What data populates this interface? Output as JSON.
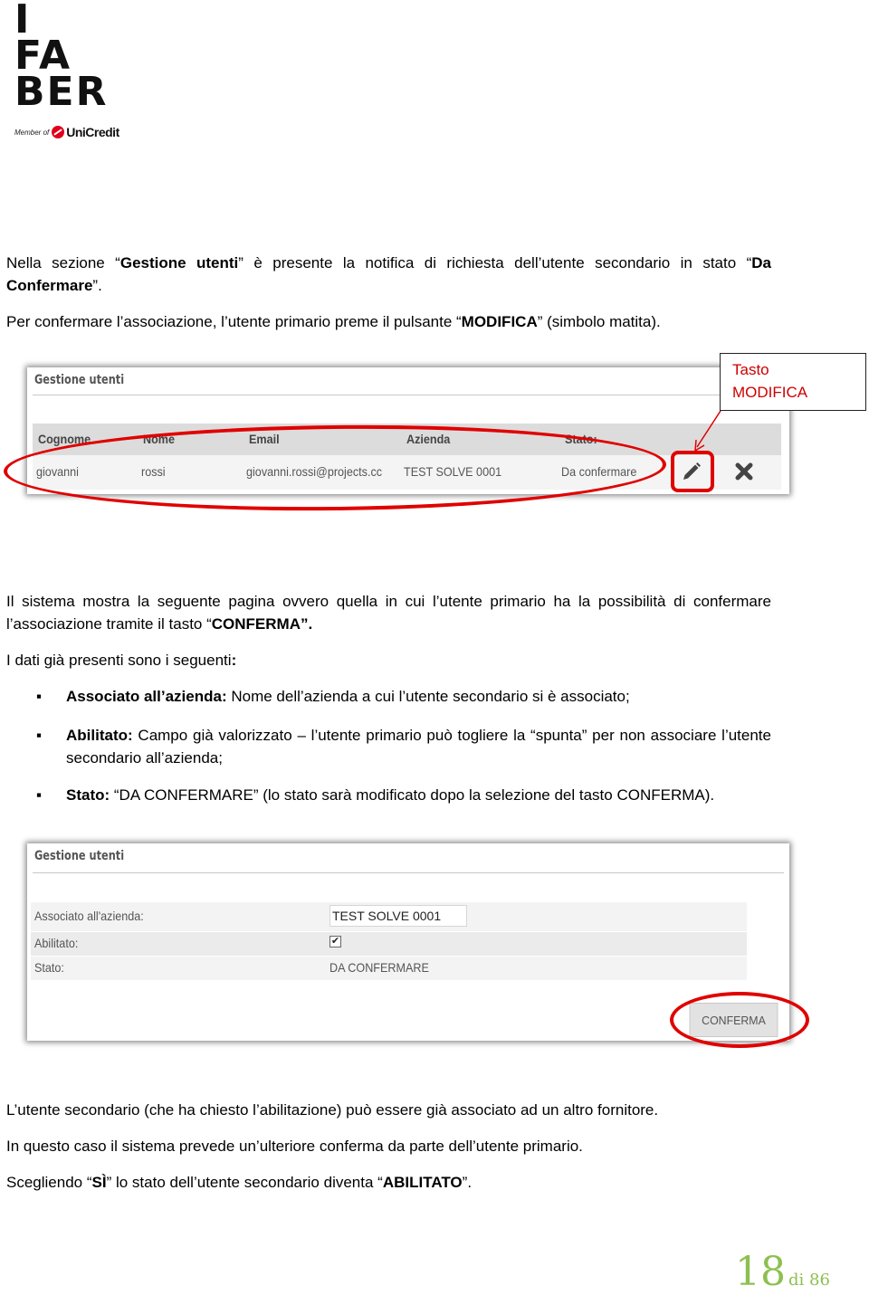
{
  "logo": {
    "lines": [
      "I",
      "FA",
      "BER"
    ],
    "member_of": "Member of",
    "brand": "UniCredit",
    "brand_color": "#e2001a"
  },
  "intro": {
    "p1": {
      "t1": "Nella sezione “",
      "b1": "Gestione utenti",
      "t2": "” è presente la notifica di richiesta dell’utente secondario in stato “",
      "b2": "Da Confermare",
      "t3": "”."
    },
    "p2": {
      "t1": "Per confermare l’associazione, l’utente primario preme il pulsante “",
      "b1": "MODIFICA",
      "t2": "” (simbolo matita)."
    }
  },
  "screenshot1": {
    "title": "Gestione utenti",
    "columns": [
      "Cognome",
      "Nome",
      "Email",
      "Azienda",
      "Stato:"
    ],
    "rows": [
      {
        "cognome": "giovanni",
        "nome": "rossi",
        "email": "giovanni.rossi@projects.cc",
        "azienda": "TEST SOLVE 0001",
        "stato": "Da confermare",
        "actions": [
          "pencil-icon",
          "delete-x-icon"
        ]
      }
    ],
    "callout": {
      "line1": "Tasto",
      "line2": "MODIFICA"
    },
    "highlight_color": "#e00000"
  },
  "middle": {
    "p1": {
      "t1": "Il sistema mostra la seguente pagina ovvero quella in cui l’utente primario ha la possibilità di confermare l’associazione tramite il tasto “",
      "b1": "CONFERMA",
      "t2": "”."
    },
    "p2": {
      "t1": "I dati già presenti sono i seguenti",
      "b1": ":"
    },
    "bullets": [
      {
        "bold": "Associato all’azienda:",
        "text": " Nome dell’azienda a cui l’utente secondario si è associato;"
      },
      {
        "bold": "Abilitato:",
        "text": " Campo già valorizzato – l’utente primario può togliere la “spunta” per non associare l’utente  secondario all’azienda;"
      },
      {
        "bold": "Stato:",
        "text": " “DA CONFERMARE” (lo stato sarà modificato dopo la selezione del tasto CONFERMA)."
      }
    ]
  },
  "screenshot2": {
    "title": "Gestione utenti",
    "fields": [
      {
        "label": "Associato all'azienda:",
        "value": "TEST SOLVE 0001",
        "type": "input"
      },
      {
        "label": "Abilitato:",
        "checked": true,
        "check_glyph": "✔",
        "type": "checkbox"
      },
      {
        "label": "Stato:",
        "value": "DA CONFERMARE",
        "type": "text"
      }
    ],
    "button": "CONFERMA"
  },
  "closing": {
    "p1": "L’utente secondario (che ha chiesto l’abilitazione) può essere già associato ad un altro fornitore.",
    "p2": "In questo caso il sistema prevede un’ulteriore conferma da parte dell’utente primario.",
    "p3": {
      "t1": "Scegliendo “",
      "b1": "SÌ",
      "t2": "” lo stato dell’utente secondario diventa “",
      "b2": "ABILITATO",
      "t3": "”."
    }
  },
  "page": {
    "current": "18",
    "of_label": "di 86",
    "color": "#8dc050"
  }
}
